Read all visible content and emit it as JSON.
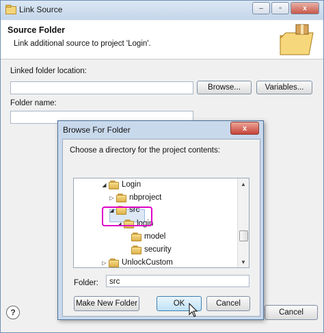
{
  "window": {
    "title": "Link Source",
    "controls": {
      "minimize": "–",
      "maximize": "▫",
      "close": "x"
    }
  },
  "header": {
    "title": "Source Folder",
    "description": "Link additional source to project 'Login'."
  },
  "form": {
    "linked_location_label": "Linked folder location:",
    "linked_location_value": "",
    "browse_label": "Browse...",
    "variables_label": "Variables...",
    "folder_name_label": "Folder name:",
    "folder_name_value": ""
  },
  "footer": {
    "help_label": "?",
    "cancel_label": "Cancel"
  },
  "browse_dialog": {
    "title": "Browse For Folder",
    "close_label": "x",
    "instruction": "Choose a directory for the project contents:",
    "tree": [
      {
        "label": "Login",
        "expander": "expanded"
      },
      {
        "label": "nbproject",
        "expander": "collapsed"
      },
      {
        "label": "src",
        "expander": "expanded",
        "selected": true
      },
      {
        "label": "login",
        "expander": "expanded"
      },
      {
        "label": "model",
        "expander": "none"
      },
      {
        "label": "security",
        "expander": "none"
      },
      {
        "label": "UnlockCustom",
        "expander": "collapsed"
      }
    ],
    "folder_label": "Folder:",
    "folder_value": "src",
    "make_new_folder_label": "Make New Folder",
    "ok_label": "OK",
    "cancel_label": "Cancel"
  },
  "colors": {
    "highlight_box": "#e000c8",
    "dialog_frame": "#c9d9ec"
  }
}
